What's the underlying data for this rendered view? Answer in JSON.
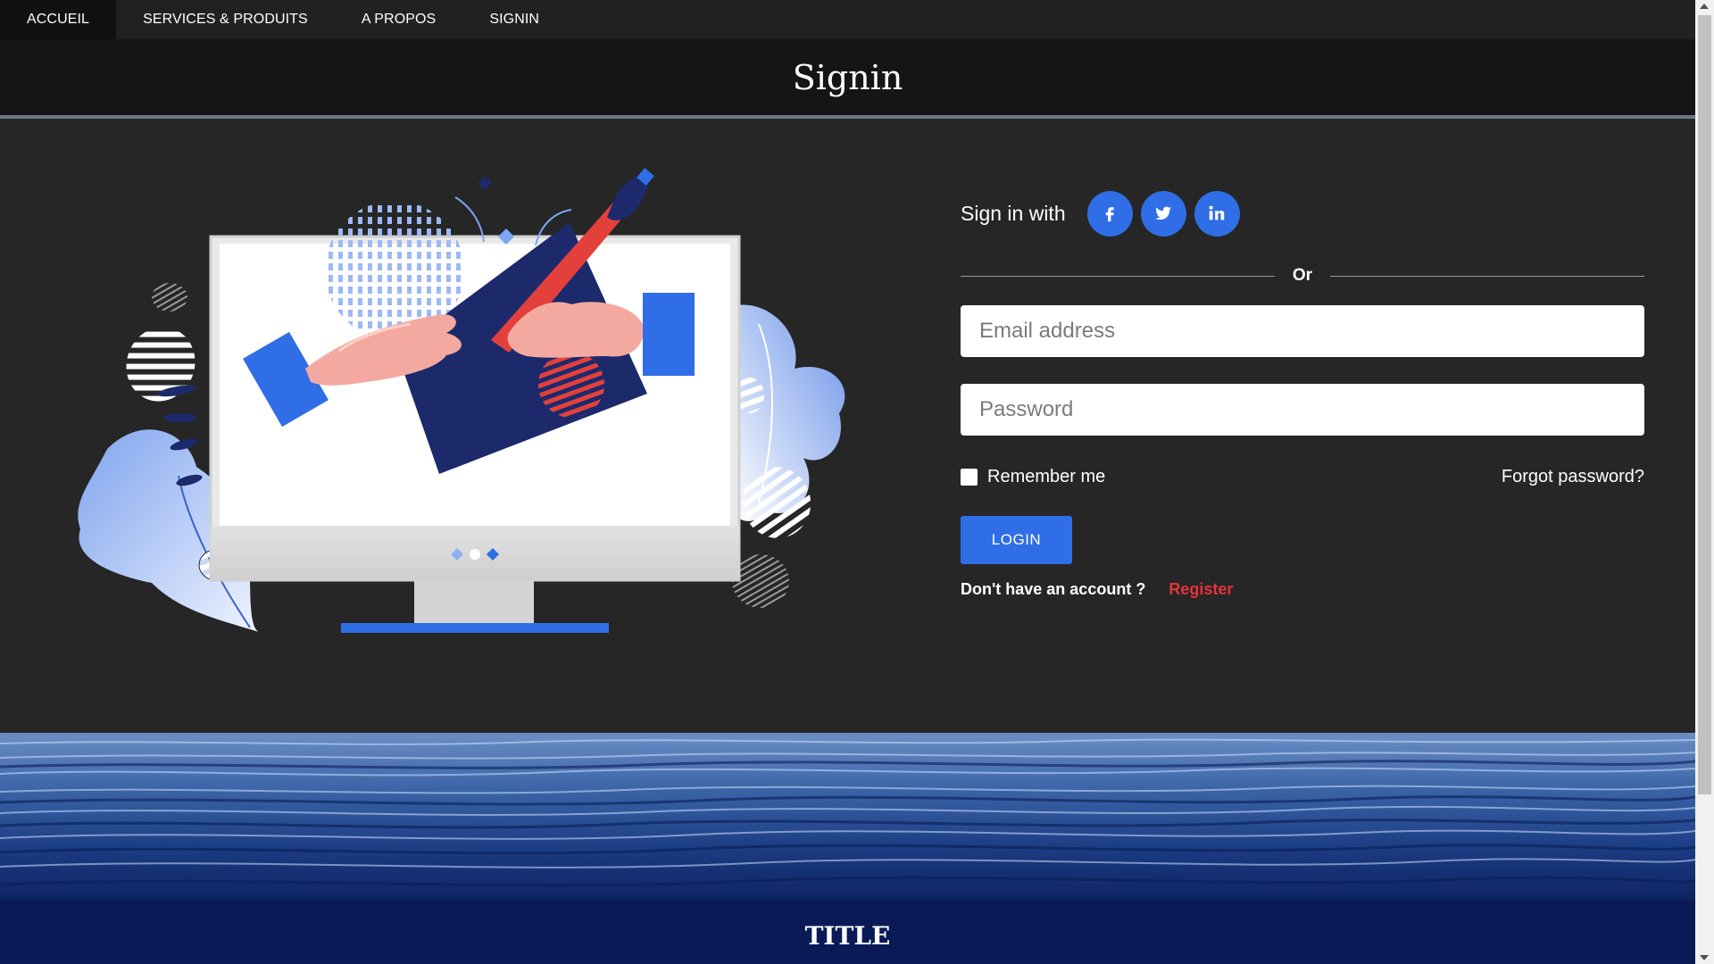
{
  "nav": {
    "items": [
      {
        "label": "ACCUEIL",
        "active": true
      },
      {
        "label": "SERVICES & PRODUITS",
        "active": false
      },
      {
        "label": "A PROPOS",
        "active": false
      },
      {
        "label": "SIGNIN",
        "active": false
      }
    ]
  },
  "header": {
    "title": "Signin"
  },
  "signin": {
    "with_label": "Sign in with",
    "social": [
      {
        "name": "facebook-icon",
        "glyph": "f"
      },
      {
        "name": "twitter-icon",
        "glyph": "twitter"
      },
      {
        "name": "linkedin-icon",
        "glyph": "in"
      }
    ],
    "divider_text": "Or",
    "email_placeholder": "Email address",
    "password_placeholder": "Password",
    "remember_label": "Remember me",
    "forgot_label": "Forgot password?",
    "login_label": "LOGIN",
    "no_account_text": "Don't have an account ?",
    "register_label": "Register"
  },
  "footer": {
    "title": "TITLE"
  },
  "colors": {
    "accent": "#2f6ee6",
    "register": "#e4333a",
    "background": "#262626",
    "footer": "#0a1a57"
  }
}
